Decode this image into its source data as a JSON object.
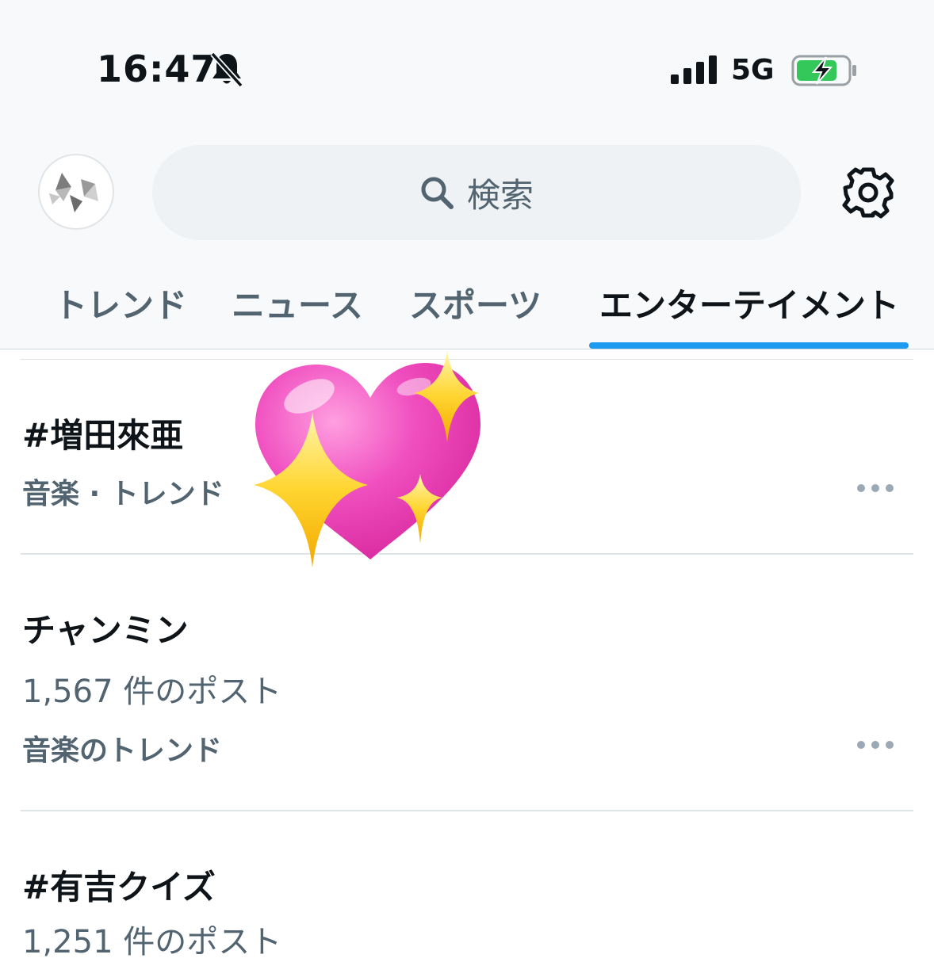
{
  "status_bar": {
    "time": "16:47",
    "network": "5G",
    "icons": [
      "bell-slash-icon",
      "signal-icon",
      "battery-charging-icon"
    ]
  },
  "header": {
    "avatar_icon": "profile-avatar",
    "search_placeholder": "検索",
    "search_icon": "search-icon",
    "settings_icon": "gear-icon"
  },
  "tabs": [
    {
      "label": "トレンド",
      "active": false
    },
    {
      "label": "ニュース",
      "active": false
    },
    {
      "label": "スポーツ",
      "active": false
    },
    {
      "label": "エンターテイメント",
      "active": true
    }
  ],
  "trends": [
    {
      "title": "#増田來亜",
      "context": "音楽 · トレンド"
    },
    {
      "title": "チャンミン",
      "count": "1,567 件のポスト",
      "context": "音楽のトレンド"
    },
    {
      "title": "#有吉クイズ",
      "count": "1,251 件のポスト"
    }
  ],
  "colors": {
    "accent": "#1d9bf0",
    "text_primary": "#0f1419",
    "text_secondary": "#536471",
    "search_bg": "#eef2f4",
    "battery_green": "#34c759"
  },
  "overlay_sticker": "sparkling-heart-emoji"
}
